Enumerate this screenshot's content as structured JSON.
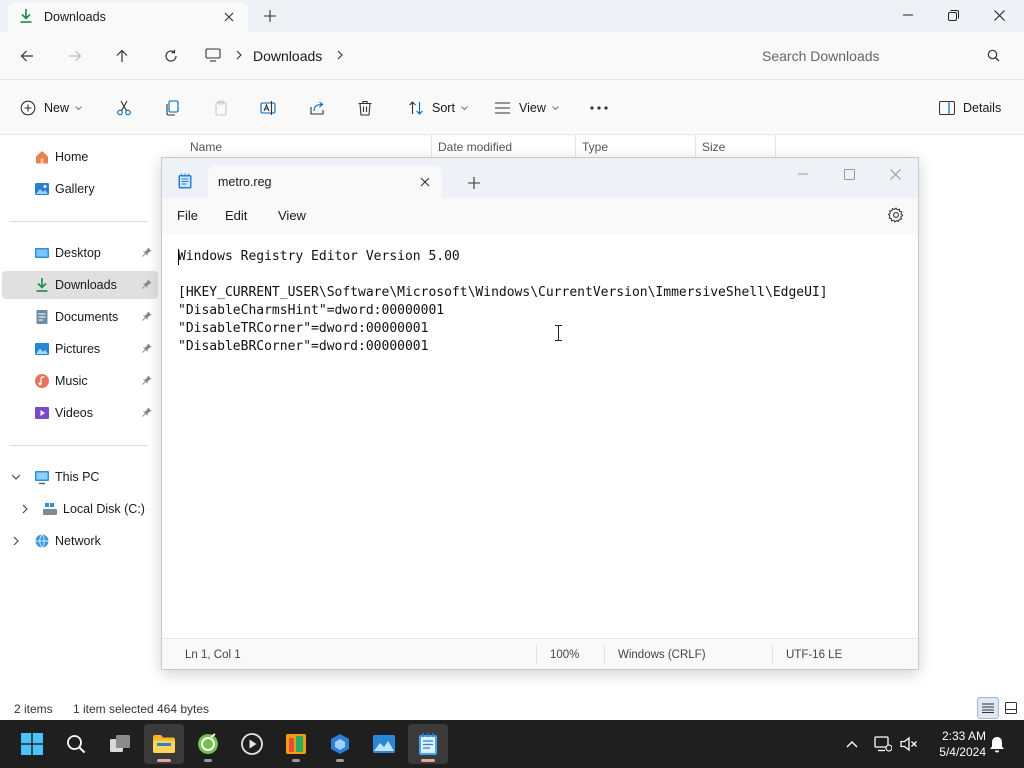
{
  "explorer": {
    "tab_title": "Downloads",
    "breadcrumb": "Downloads",
    "search_placeholder": "Search Downloads",
    "toolbar": {
      "new_label": "New",
      "sort_label": "Sort",
      "view_label": "View",
      "details_label": "Details"
    },
    "sidebar": {
      "home": "Home",
      "gallery": "Gallery",
      "desktop": "Desktop",
      "downloads": "Downloads",
      "documents": "Documents",
      "pictures": "Pictures",
      "music": "Music",
      "videos": "Videos",
      "this_pc": "This PC",
      "local_disk": "Local Disk (C:)",
      "network": "Network"
    },
    "columns": [
      "Name",
      "Date modified",
      "Type",
      "Size"
    ],
    "status": {
      "items": "2 items",
      "selected": "1 item selected",
      "size": "464 bytes"
    }
  },
  "notepad": {
    "tab_title": "metro.reg",
    "menu": [
      "File",
      "Edit",
      "View"
    ],
    "content": "Windows Registry Editor Version 5.00\n\n[HKEY_CURRENT_USER\\Software\\Microsoft\\Windows\\CurrentVersion\\ImmersiveShell\\EdgeUI]\n\"DisableCharmsHint\"=dword:00000001\n\"DisableTRCorner\"=dword:00000001\n\"DisableBRCorner\"=dword:00000001",
    "status": {
      "position": "Ln 1, Col 1",
      "zoom": "100%",
      "line_ending": "Windows (CRLF)",
      "encoding": "UTF-16 LE"
    }
  },
  "taskbar": {
    "time": "2:33 AM",
    "date": "5/4/2024"
  },
  "colors": {
    "accent": "#0067c0",
    "taskbar_bg": "#1f1f1f",
    "selected_bg": "#e0e0e0"
  }
}
